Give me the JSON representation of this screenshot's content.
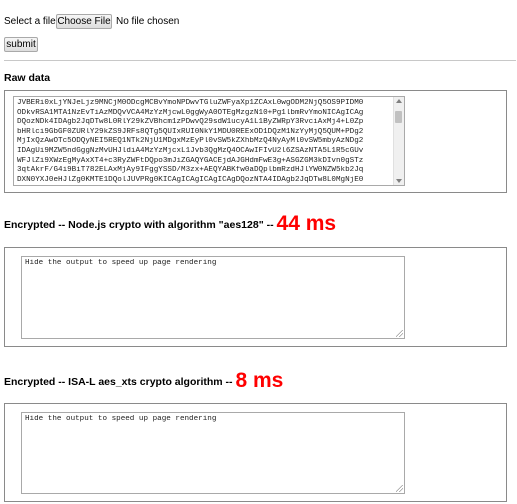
{
  "form": {
    "select_label": "Select a file:",
    "choose_file_label": "Choose File",
    "no_file_text": "No file chosen",
    "submit_label": "submit"
  },
  "raw": {
    "heading": "Raw data",
    "lines": [
      "JVBERi0xLjYNJeLjz9MNCjM0ODcgMCBvYmoNPDwvTGluZWFyaXp1ZCAxL0wgODM2NjQ5OS9PIDM0",
      "ODkvRSA1MTA1NzEvTiAzMDQvVCA4MzYzMjcwL0ggWyA0OTEgMzgzN10+Pg1lbmRvYmoNICAgICAg",
      "DQozNDk4IDAgb2JqDTw8L0RlY29kZVBhcm1zPDwvQ29sdW1ucyA1L1ByZWRpY3RvciAxMj4+L0Zp",
      "bHRlci9GbGF0ZURlY29kZS9JRFs8QTg5QUIxRUI0NkY1MDU0REExOD1DQzM1NzYyMjQ5QUM+PDg2",
      "MjIxQzAwOTc5ODQyNEI5REQ1NTk2NjU1MDgxMzEyPl0vSW5kZXhbMzQ4NyAyMl0vSW5mbyAzNDg2",
      "IDAgUi9MZW5ndGggNzMvUHJldiA4MzYzMjcxL1Jvb3QgMzQ4OCAwIFIvU2l6ZSAzNTA5L1R5cGUv",
      "WFJlZi9XWzEgMyAxXT4+c3RyZWFtDQpo3mJiZGAQYGACEjdAJGHdmFwE3g+ASGZGM3kDIvn0gSTz",
      "3qtAkrF/G4i9BiT782ELAxMjAy9IFggYSSD/M3zx+AEQYABKfw0aDQplbmRzdHJlYW0NZW5kb2Jq",
      "DXN0YXJ0eHJlZg0KMTE1DQolJUVPRg0KICAgICAgICAgICAgDQozNTA4IDAgb2JqDTw8L0MgNjE0"
    ]
  },
  "node": {
    "heading_text": "Encrypted -- Node.js crypto with algorithm \"aes128\" --",
    "timing": "44 ms",
    "output_placeholder": "Hide the output to speed up page rendering"
  },
  "isal": {
    "heading_text": "Encrypted -- ISA-L aes_xts crypto algorithm --",
    "timing": "8 ms",
    "output_placeholder": "Hide the output to speed up page rendering"
  }
}
